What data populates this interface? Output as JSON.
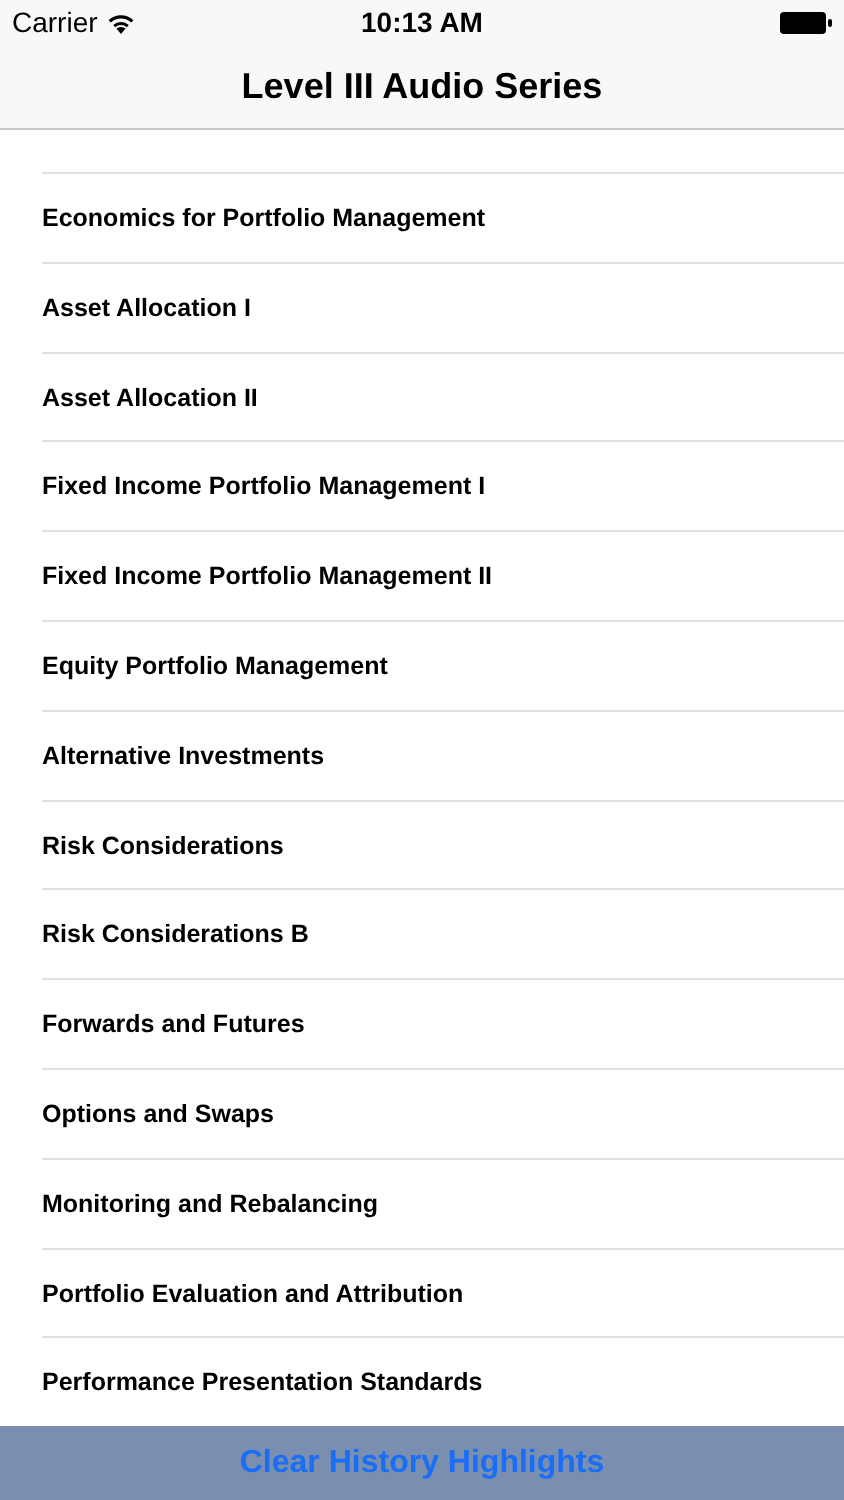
{
  "status_bar": {
    "carrier": "Carrier",
    "time": "10:13 AM"
  },
  "nav_bar": {
    "title": "Level III Audio Series"
  },
  "list": {
    "items": [
      {
        "label": "Economics for Portfolio Management"
      },
      {
        "label": "Asset Allocation I"
      },
      {
        "label": "Asset Allocation II"
      },
      {
        "label": "Fixed Income Portfolio Management I"
      },
      {
        "label": "Fixed Income Portfolio Management II"
      },
      {
        "label": "Equity Portfolio Management"
      },
      {
        "label": "Alternative Investments"
      },
      {
        "label": "Risk Considerations"
      },
      {
        "label": "Risk Considerations B"
      },
      {
        "label": "Forwards and Futures"
      },
      {
        "label": "Options and Swaps"
      },
      {
        "label": "Monitoring and Rebalancing"
      },
      {
        "label": "Portfolio Evaluation and Attribution"
      },
      {
        "label": "Performance Presentation Standards"
      }
    ]
  },
  "bottom_button": {
    "label": "Clear History Highlights"
  }
}
